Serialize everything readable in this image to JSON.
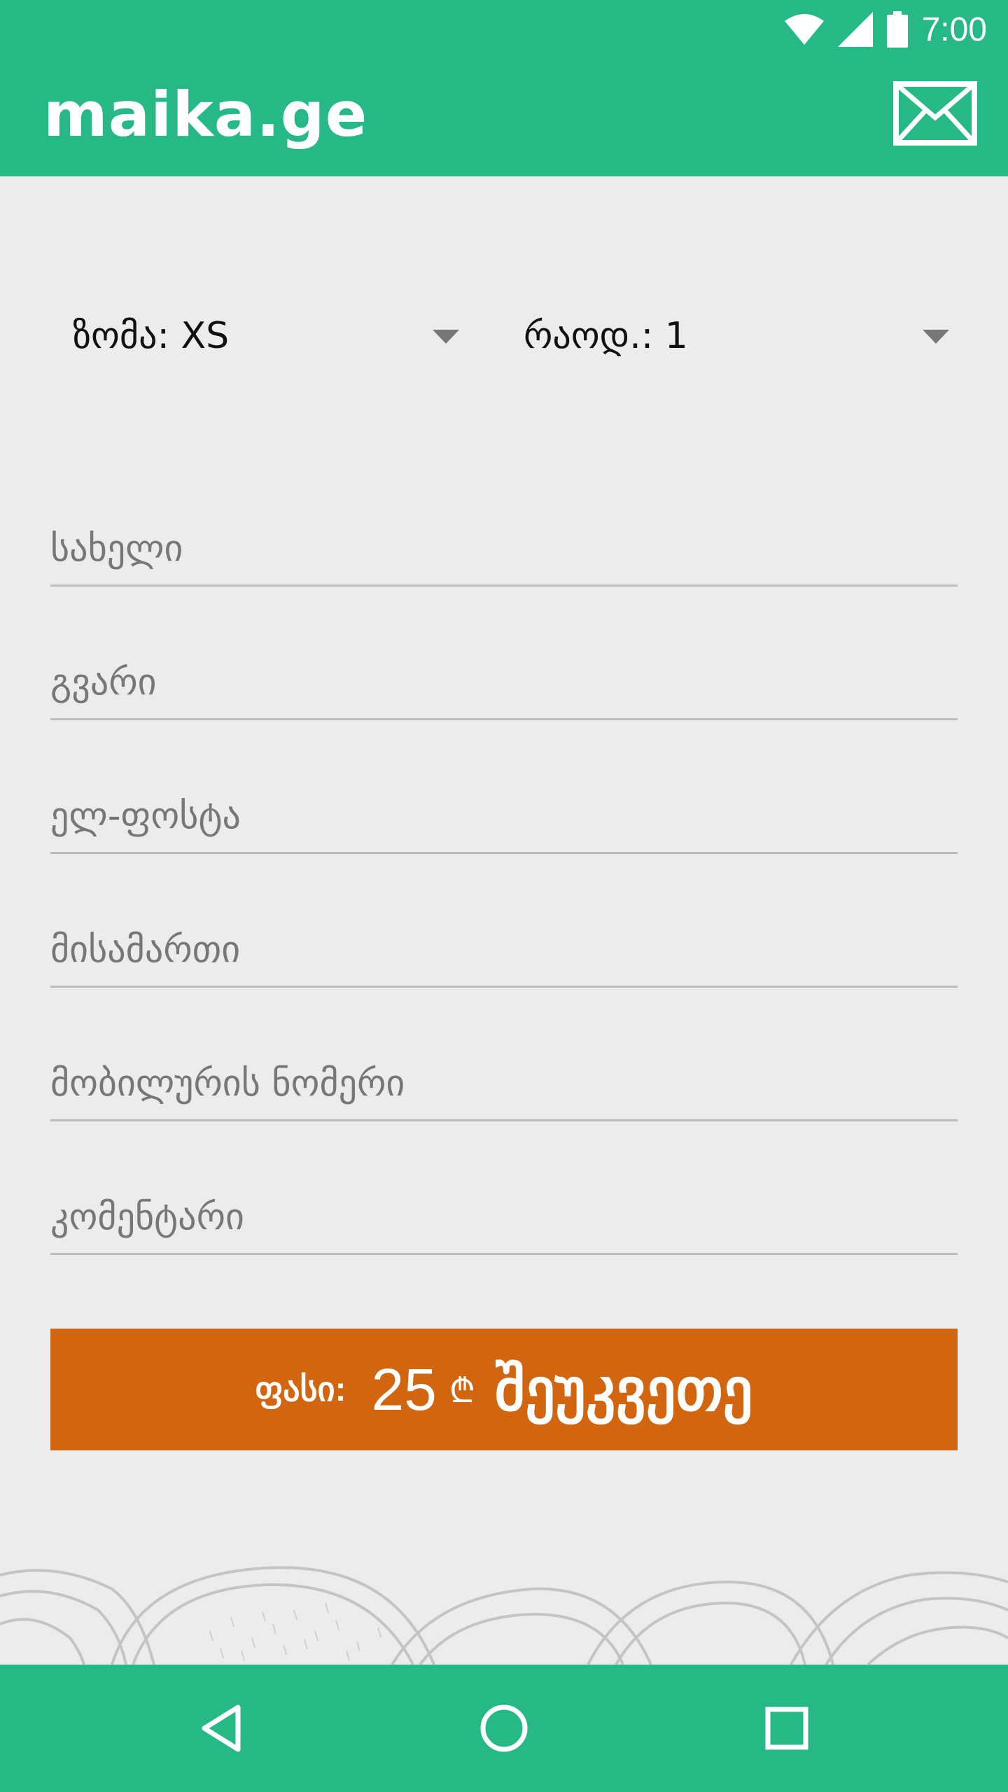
{
  "status_bar": {
    "time": "7:00"
  },
  "app_bar": {
    "title": "maika.ge",
    "mail_icon": "mail-icon"
  },
  "order_options": {
    "size_label": "ზომა: XS",
    "quantity_label": "რაოდ.: 1"
  },
  "form": {
    "first_name_placeholder": "სახელი",
    "last_name_placeholder": "გვარი",
    "email_placeholder": "ელ-ფოსტა",
    "address_placeholder": "მისამართი",
    "phone_placeholder": "მობილურის ნომერი",
    "comment_placeholder": "კომენტარი"
  },
  "order_button": {
    "price_label": "ფასი:",
    "price_value": "25",
    "currency_symbol": "₾",
    "label": "შეუკვეთე"
  },
  "colors": {
    "primary": "#26b986",
    "accent": "#d2650f",
    "background": "#ececec"
  },
  "nav_icons": [
    "back-icon",
    "home-icon",
    "recents-icon"
  ]
}
